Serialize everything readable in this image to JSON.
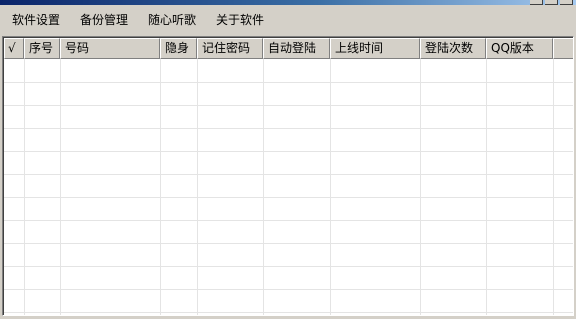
{
  "menu": [
    "软件设置",
    "备份管理",
    "随心听歌",
    "关于软件"
  ],
  "table": {
    "columns": [
      "√",
      "序号",
      "号码",
      "隐身",
      "记住密码",
      "自动登陆",
      "上线时间",
      "登陆次数",
      "QQ版本"
    ],
    "rows": []
  }
}
